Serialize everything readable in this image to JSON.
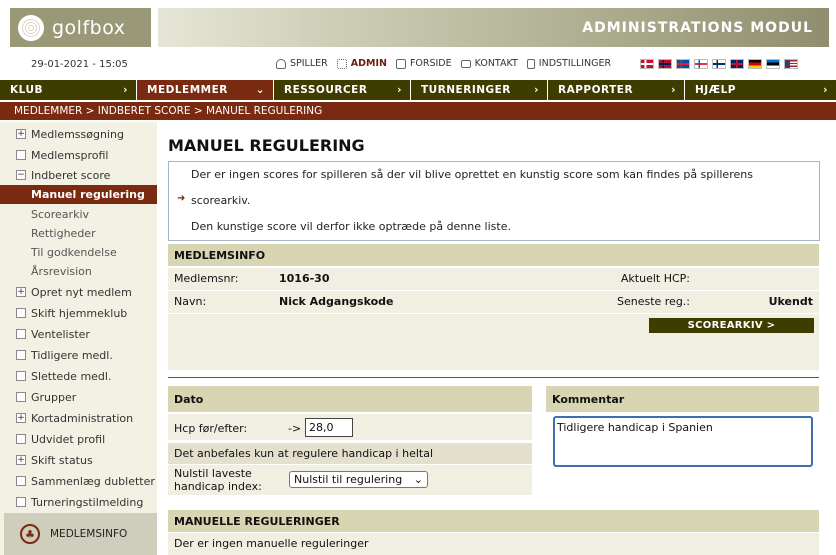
{
  "header": {
    "logo_text": "golfbox",
    "banner_title": "ADMINISTRATIONS MODUL",
    "date": "29-01-2021 - 15:05",
    "topnav": [
      {
        "label": "SPILLER",
        "icon": "person-icon"
      },
      {
        "label": "ADMIN",
        "icon": "grid-icon",
        "active": true
      },
      {
        "label": "FORSIDE",
        "icon": "home-icon"
      },
      {
        "label": "KONTAKT",
        "icon": "mail-icon"
      },
      {
        "label": "INDSTILLINGER",
        "icon": "document-icon"
      }
    ],
    "flags": [
      "dk",
      "no",
      "is",
      "fo",
      "fi",
      "gb",
      "de",
      "ee",
      "us"
    ]
  },
  "mainnav": [
    {
      "label": "KLUB",
      "indicator": "›"
    },
    {
      "label": "MEDLEMMER",
      "indicator": "⌄",
      "active": true
    },
    {
      "label": "RESSOURCER",
      "indicator": "›"
    },
    {
      "label": "TURNERINGER",
      "indicator": "›"
    },
    {
      "label": "RAPPORTER",
      "indicator": "›"
    },
    {
      "label": "HJÆLP",
      "indicator": "›"
    }
  ],
  "breadcrumb": "MEDLEMMER > INDBERET SCORE > MANUEL REGULERING",
  "sidebar": {
    "items": [
      {
        "label": "Medlemssøgning",
        "box": "+"
      },
      {
        "label": "Medlemsprofil",
        "box": ""
      },
      {
        "label": "Indberet score",
        "box": "−"
      },
      {
        "label": "Manuel regulering",
        "sub": true,
        "selected": true
      },
      {
        "label": "Scorearkiv",
        "sub": true
      },
      {
        "label": "Rettigheder",
        "sub": true
      },
      {
        "label": "Til godkendelse",
        "sub": true
      },
      {
        "label": "Årsrevision",
        "sub": true
      },
      {
        "label": "Opret nyt medlem",
        "box": "+"
      },
      {
        "label": "Skift hjemmeklub",
        "box": ""
      },
      {
        "label": "Ventelister",
        "box": ""
      },
      {
        "label": "Tidligere medl.",
        "box": ""
      },
      {
        "label": "Slettede medl.",
        "box": ""
      },
      {
        "label": "Grupper",
        "box": ""
      },
      {
        "label": "Kortadministration",
        "box": "+"
      },
      {
        "label": "Udvidet profil",
        "box": ""
      },
      {
        "label": "Skift status",
        "box": "+"
      },
      {
        "label": "Sammenlæg dubletter",
        "box": ""
      },
      {
        "label": "Turneringstilmelding",
        "box": ""
      }
    ],
    "footer_label": "MEDLEMSINFO"
  },
  "main": {
    "title": "MANUEL REGULERING",
    "message": {
      "line1": "Der er ingen scores for spilleren så der vil blive oprettet en kunstig score som kan findes på spillerens",
      "line2": "scorearkiv.",
      "line3": "Den kunstige score vil derfor ikke optræde på denne liste."
    },
    "medlemsinfo": {
      "header": "MEDLEMSINFO",
      "medlemsnr_label": "Medlemsnr:",
      "medlemsnr_value": "1016-30",
      "navn_label": "Navn:",
      "navn_value": "Nick Adgangskode",
      "aktuelt_hcp_label": "Aktuelt HCP:",
      "aktuelt_hcp_value": "",
      "seneste_reg_label": "Seneste reg.:",
      "seneste_reg_value": "Ukendt",
      "scorearkiv_button": "SCOREARKIV >"
    },
    "dato": {
      "header": "Dato",
      "hcp_label": "Hcp før/efter:",
      "hcp_arrow": "->",
      "hcp_value": "28,0",
      "note": "Det anbefales kun at regulere handicap i heltal",
      "nulstil_label_1": "Nulstil laveste",
      "nulstil_label_2": "handicap index:",
      "nulstil_selected": "Nulstil til regulering"
    },
    "kommentar": {
      "header": "Kommentar",
      "value": "Tidligere handicap i Spanien"
    },
    "manuelle": {
      "header": "MANUELLE REGULERINGER",
      "empty_text": "Der er ingen manuelle reguleringer"
    }
  }
}
